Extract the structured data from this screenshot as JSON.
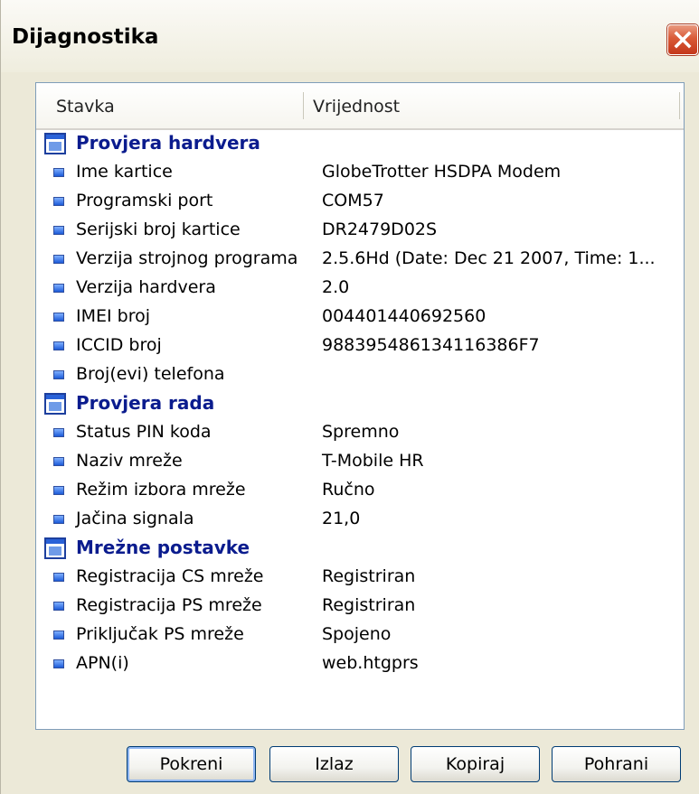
{
  "window": {
    "title": "Dijagnostika"
  },
  "columns": {
    "item": "Stavka",
    "value": "Vrijednost"
  },
  "groups": [
    {
      "label": "Provjera hardvera",
      "rows": [
        {
          "name": "Ime kartice",
          "value": "GlobeTrotter HSDPA Modem"
        },
        {
          "name": "Programski port",
          "value": "COM57"
        },
        {
          "name": "Serijski broj kartice",
          "value": "DR2479D02S"
        },
        {
          "name": "Verzija strojnog programa",
          "value": "2.5.6Hd (Date: Dec 21 2007, Time: 1..."
        },
        {
          "name": "Verzija hardvera",
          "value": "2.0"
        },
        {
          "name": "IMEI broj",
          "value": "004401440692560"
        },
        {
          "name": "ICCID broj",
          "value": "988395486134116386F7"
        },
        {
          "name": "Broj(evi) telefona",
          "value": ""
        }
      ]
    },
    {
      "label": "Provjera rada",
      "rows": [
        {
          "name": "Status PIN koda",
          "value": "Spremno"
        },
        {
          "name": "Naziv mreže",
          "value": "T-Mobile HR"
        },
        {
          "name": "Režim izbora mreže",
          "value": "Ručno"
        },
        {
          "name": "Jačina signala",
          "value": "21,0"
        }
      ]
    },
    {
      "label": "Mrežne postavke",
      "rows": [
        {
          "name": "Registracija CS mreže",
          "value": "Registriran"
        },
        {
          "name": "Registracija PS mreže",
          "value": "Registriran"
        },
        {
          "name": "Priključak PS mreže",
          "value": "Spojeno"
        },
        {
          "name": "APN(i)",
          "value": "web.htgprs"
        }
      ]
    }
  ],
  "buttons": {
    "start": "Pokreni",
    "exit": "Izlaz",
    "copy": "Kopiraj",
    "save": "Pohrani"
  }
}
